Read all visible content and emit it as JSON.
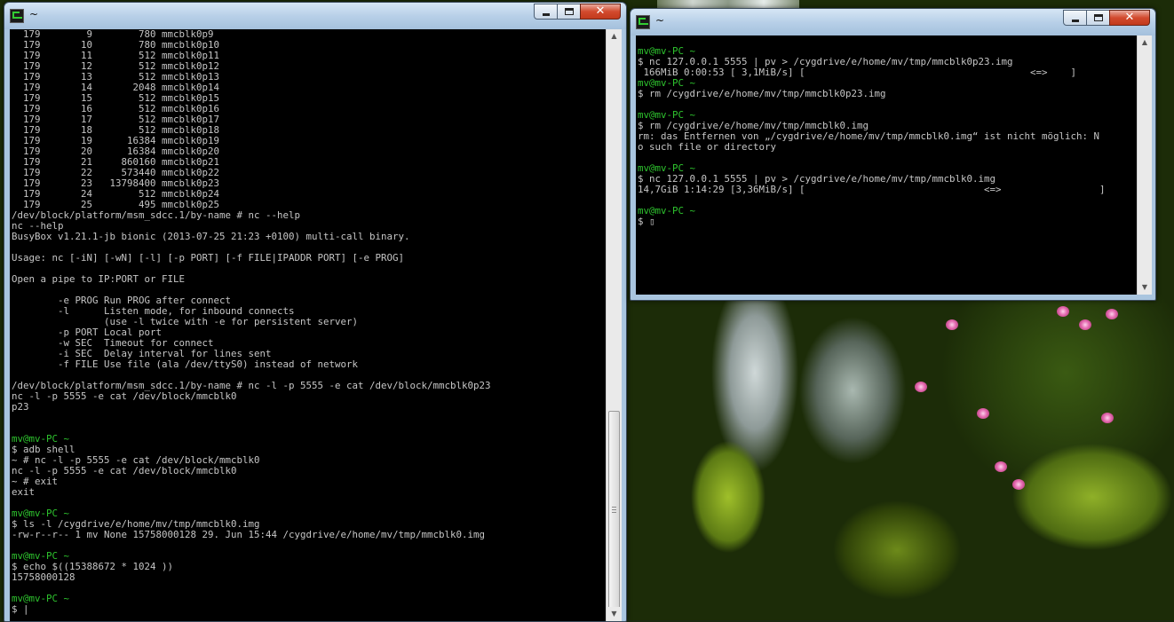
{
  "windows": {
    "left": {
      "title": "~",
      "controls": {
        "minimize": "minimize",
        "maximize": "maximize",
        "close": "✕"
      },
      "lines": [
        {
          "t": "  179        9        780 mmcblk0p9",
          "k": "out"
        },
        {
          "t": "  179       10        780 mmcblk0p10",
          "k": "out"
        },
        {
          "t": "  179       11        512 mmcblk0p11",
          "k": "out"
        },
        {
          "t": "  179       12        512 mmcblk0p12",
          "k": "out"
        },
        {
          "t": "  179       13        512 mmcblk0p13",
          "k": "out"
        },
        {
          "t": "  179       14       2048 mmcblk0p14",
          "k": "out"
        },
        {
          "t": "  179       15        512 mmcblk0p15",
          "k": "out"
        },
        {
          "t": "  179       16        512 mmcblk0p16",
          "k": "out"
        },
        {
          "t": "  179       17        512 mmcblk0p17",
          "k": "out"
        },
        {
          "t": "  179       18        512 mmcblk0p18",
          "k": "out"
        },
        {
          "t": "  179       19      16384 mmcblk0p19",
          "k": "out"
        },
        {
          "t": "  179       20      16384 mmcblk0p20",
          "k": "out"
        },
        {
          "t": "  179       21     860160 mmcblk0p21",
          "k": "out"
        },
        {
          "t": "  179       22     573440 mmcblk0p22",
          "k": "out"
        },
        {
          "t": "  179       23   13798400 mmcblk0p23",
          "k": "out"
        },
        {
          "t": "  179       24        512 mmcblk0p24",
          "k": "out"
        },
        {
          "t": "  179       25        495 mmcblk0p25",
          "k": "out"
        },
        {
          "t": "/dev/block/platform/msm_sdcc.1/by-name # nc --help",
          "k": "out"
        },
        {
          "t": "nc --help",
          "k": "out"
        },
        {
          "t": "BusyBox v1.21.1-jb bionic (2013-07-25 21:23 +0100) multi-call binary.",
          "k": "out"
        },
        {
          "t": "",
          "k": "out"
        },
        {
          "t": "Usage: nc [-iN] [-wN] [-l] [-p PORT] [-f FILE|IPADDR PORT] [-e PROG]",
          "k": "out"
        },
        {
          "t": "",
          "k": "out"
        },
        {
          "t": "Open a pipe to IP:PORT or FILE",
          "k": "out"
        },
        {
          "t": "",
          "k": "out"
        },
        {
          "t": "        -e PROG Run PROG after connect",
          "k": "out"
        },
        {
          "t": "        -l      Listen mode, for inbound connects",
          "k": "out"
        },
        {
          "t": "                (use -l twice with -e for persistent server)",
          "k": "out"
        },
        {
          "t": "        -p PORT Local port",
          "k": "out"
        },
        {
          "t": "        -w SEC  Timeout for connect",
          "k": "out"
        },
        {
          "t": "        -i SEC  Delay interval for lines sent",
          "k": "out"
        },
        {
          "t": "        -f FILE Use file (ala /dev/ttyS0) instead of network",
          "k": "out"
        },
        {
          "t": "",
          "k": "out"
        },
        {
          "t": "/dev/block/platform/msm_sdcc.1/by-name # nc -l -p 5555 -e cat /dev/block/mmcblk0p23",
          "k": "out"
        },
        {
          "t": "nc -l -p 5555 -e cat /dev/block/mmcblk0",
          "k": "out"
        },
        {
          "t": "p23",
          "k": "out"
        },
        {
          "t": "",
          "k": "out"
        },
        {
          "t": "",
          "k": "out"
        },
        {
          "t": "mv@mv-PC ~",
          "k": "prompt"
        },
        {
          "t": "$ adb shell",
          "k": "out"
        },
        {
          "t": "~ # nc -l -p 5555 -e cat /dev/block/mmcblk0",
          "k": "out"
        },
        {
          "t": "nc -l -p 5555 -e cat /dev/block/mmcblk0",
          "k": "out"
        },
        {
          "t": "~ # exit",
          "k": "out"
        },
        {
          "t": "exit",
          "k": "out"
        },
        {
          "t": "",
          "k": "out"
        },
        {
          "t": "mv@mv-PC ~",
          "k": "prompt"
        },
        {
          "t": "$ ls -l /cygdrive/e/home/mv/tmp/mmcblk0.img",
          "k": "out"
        },
        {
          "t": "-rw-r--r-- 1 mv None 15758000128 29. Jun 15:44 /cygdrive/e/home/mv/tmp/mmcblk0.img",
          "k": "out"
        },
        {
          "t": "",
          "k": "out"
        },
        {
          "t": "mv@mv-PC ~",
          "k": "prompt"
        },
        {
          "t": "$ echo $((15388672 * 1024 ))",
          "k": "out"
        },
        {
          "t": "15758000128",
          "k": "out"
        },
        {
          "t": "",
          "k": "out"
        },
        {
          "t": "mv@mv-PC ~",
          "k": "prompt"
        },
        {
          "t": "$ |",
          "k": "out"
        }
      ]
    },
    "right": {
      "title": "~",
      "controls": {
        "minimize": "minimize",
        "maximize": "maximize",
        "close": "✕"
      },
      "lines": [
        {
          "t": "",
          "k": "out"
        },
        {
          "t": "mv@mv-PC ~",
          "k": "prompt"
        },
        {
          "t": "$ nc 127.0.0.1 5555 | pv > /cygdrive/e/home/mv/tmp/mmcblk0p23.img",
          "k": "out"
        },
        {
          "t": " 166MiB 0:00:53 [ 3,1MiB/s] [                                       <=>    ]",
          "k": "out"
        },
        {
          "t": "mv@mv-PC ~",
          "k": "prompt"
        },
        {
          "t": "$ rm /cygdrive/e/home/mv/tmp/mmcblk0p23.img",
          "k": "out"
        },
        {
          "t": "",
          "k": "out"
        },
        {
          "t": "mv@mv-PC ~",
          "k": "prompt"
        },
        {
          "t": "$ rm /cygdrive/e/home/mv/tmp/mmcblk0.img",
          "k": "out"
        },
        {
          "t": "rm: das Entfernen von „/cygdrive/e/home/mv/tmp/mmcblk0.img“ ist nicht möglich: N",
          "k": "out"
        },
        {
          "t": "o such file or directory",
          "k": "out"
        },
        {
          "t": "",
          "k": "out"
        },
        {
          "t": "mv@mv-PC ~",
          "k": "prompt"
        },
        {
          "t": "$ nc 127.0.0.1 5555 | pv > /cygdrive/e/home/mv/tmp/mmcblk0.img",
          "k": "out"
        },
        {
          "t": "14,7GiB 1:14:29 [3,36MiB/s] [                               <=>                 ]",
          "k": "out"
        },
        {
          "t": "",
          "k": "out"
        },
        {
          "t": "mv@mv-PC ~",
          "k": "prompt"
        },
        {
          "t": "$ ▯",
          "k": "out"
        }
      ]
    }
  },
  "colors": {
    "prompt": "#2ec42e",
    "text": "#c6c6c6",
    "console_bg": "#000000",
    "titlebar": "#b8d0e8",
    "close_button": "#d24a2e"
  },
  "icons": [
    "mintty-icon",
    "minimize-icon",
    "maximize-icon",
    "close-icon",
    "scroll-up-icon",
    "scroll-down-icon"
  ]
}
